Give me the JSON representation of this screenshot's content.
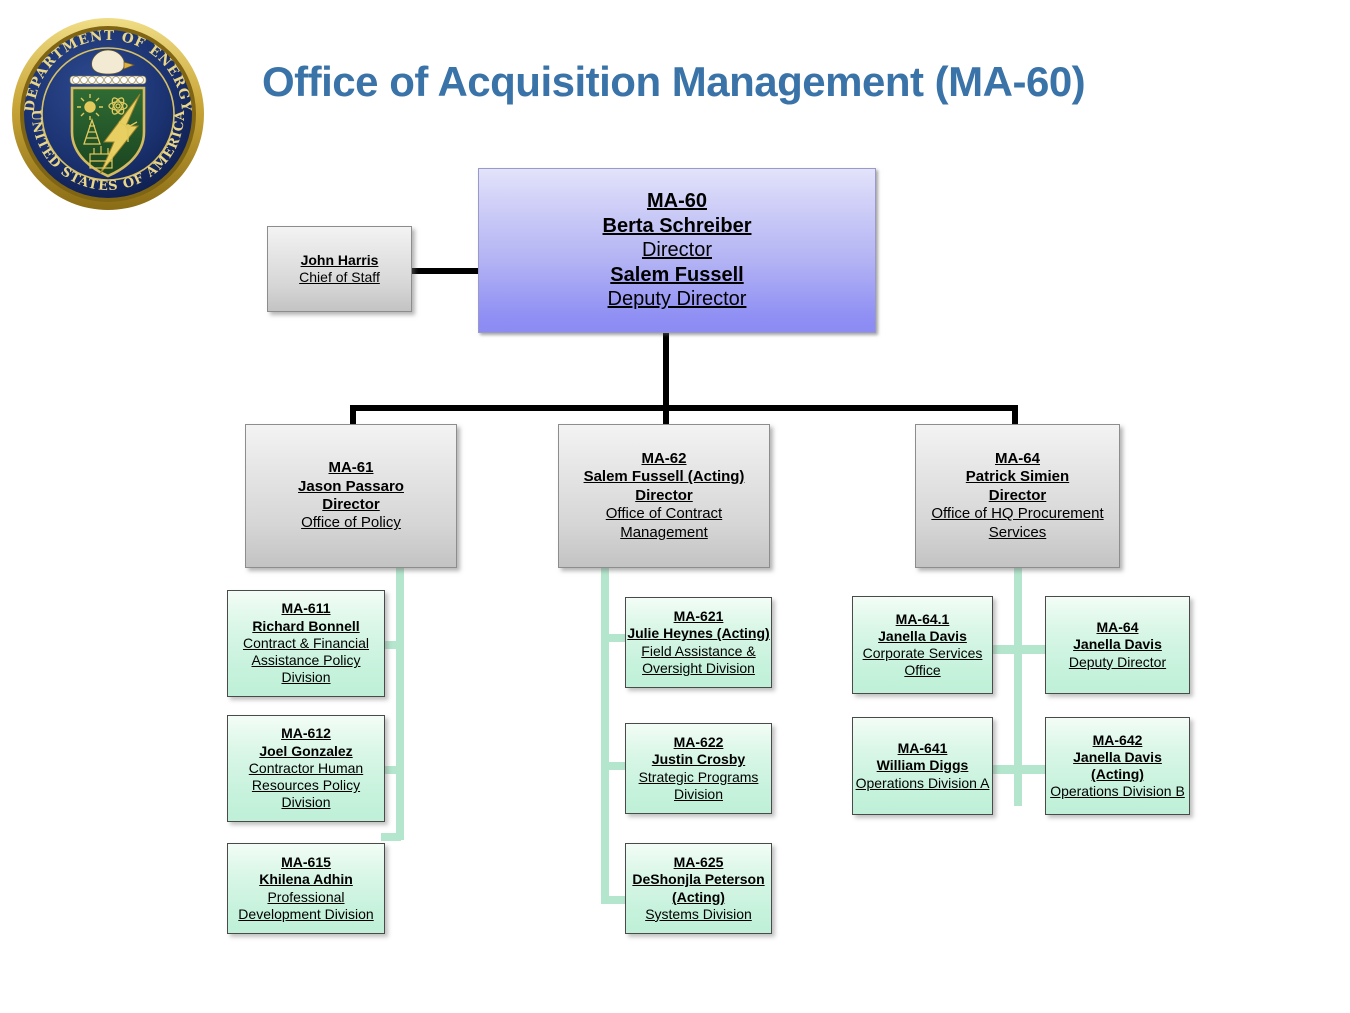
{
  "header": {
    "title": "Office of Acquisition Management (MA-60)",
    "title_color": "#3a73a8",
    "seal_name": "doe-seal",
    "seal_text_top": "DEPARTMENT OF ENERGY",
    "seal_text_bottom": "UNITED STATES OF AMERICA"
  },
  "chart_data": {
    "type": "diagram",
    "diagram_kind": "org-chart",
    "title": "Office of Acquisition Management (MA-60)"
  },
  "nodes": {
    "root": {
      "code": "MA-60",
      "name": "Berta Schreiber",
      "title": "Director",
      "name2": "Salem Fussell",
      "title2": "Deputy Director"
    },
    "chief_of_staff": {
      "name": "John Harris",
      "title": "Chief of Staff"
    },
    "ma61": {
      "code": "MA-61",
      "name": "Jason Passaro",
      "title": "Director",
      "office": "Office of Policy"
    },
    "ma62": {
      "code": "MA-62",
      "name": "Salem Fussell (Acting)",
      "title": "Director",
      "office_line1": "Office of Contract",
      "office_line2": "Management"
    },
    "ma64": {
      "code": "MA-64",
      "name": "Patrick Simien",
      "title": "Director",
      "office_line1": "Office of HQ Procurement",
      "office_line2": "Services"
    },
    "ma611": {
      "code": "MA-611",
      "name": "Richard Bonnell",
      "div_line1": "Contract & Financial",
      "div_line2": "Assistance Policy",
      "div_line3": "Division"
    },
    "ma612": {
      "code": "MA-612",
      "name": "Joel Gonzalez",
      "div_line1": "Contractor Human",
      "div_line2": "Resources Policy",
      "div_line3": "Division"
    },
    "ma615": {
      "code": "MA-615",
      "name": "Khilena Adhin",
      "div_line1": "Professional",
      "div_line2": "Development Division"
    },
    "ma621": {
      "code": "MA-621",
      "name": "Julie Heynes (Acting)",
      "div_line1": "Field Assistance &",
      "div_line2": "Oversight Division"
    },
    "ma622": {
      "code": "MA-622",
      "name": "Justin Crosby",
      "div_line1": "Strategic Programs",
      "div_line2": "Division"
    },
    "ma625": {
      "code": "MA-625",
      "name": "DeShonjla Peterson",
      "name_line2": "(Acting)",
      "div_line1": "Systems Division"
    },
    "ma641x": {
      "code": "MA-64.1",
      "name": "Janella Davis",
      "div_line1": "Corporate Services",
      "div_line2": "Office"
    },
    "ma64_deputy": {
      "code": "MA-64",
      "name": "Janella Davis",
      "div_line1": "Deputy Director"
    },
    "ma641": {
      "code": "MA-641",
      "name": "William Diggs",
      "div_line1": "Operations Division A"
    },
    "ma642": {
      "code": "MA-642",
      "name": "Janella Davis",
      "name_line2": "(Acting)",
      "div_line1": "Operations Division B"
    }
  },
  "colors": {
    "root_box": "#8e8ef4",
    "gray_box": "#d6d6d6",
    "green_box": "#c6f2dc",
    "connector_black": "#000000",
    "connector_green": "#b4e6cd"
  }
}
